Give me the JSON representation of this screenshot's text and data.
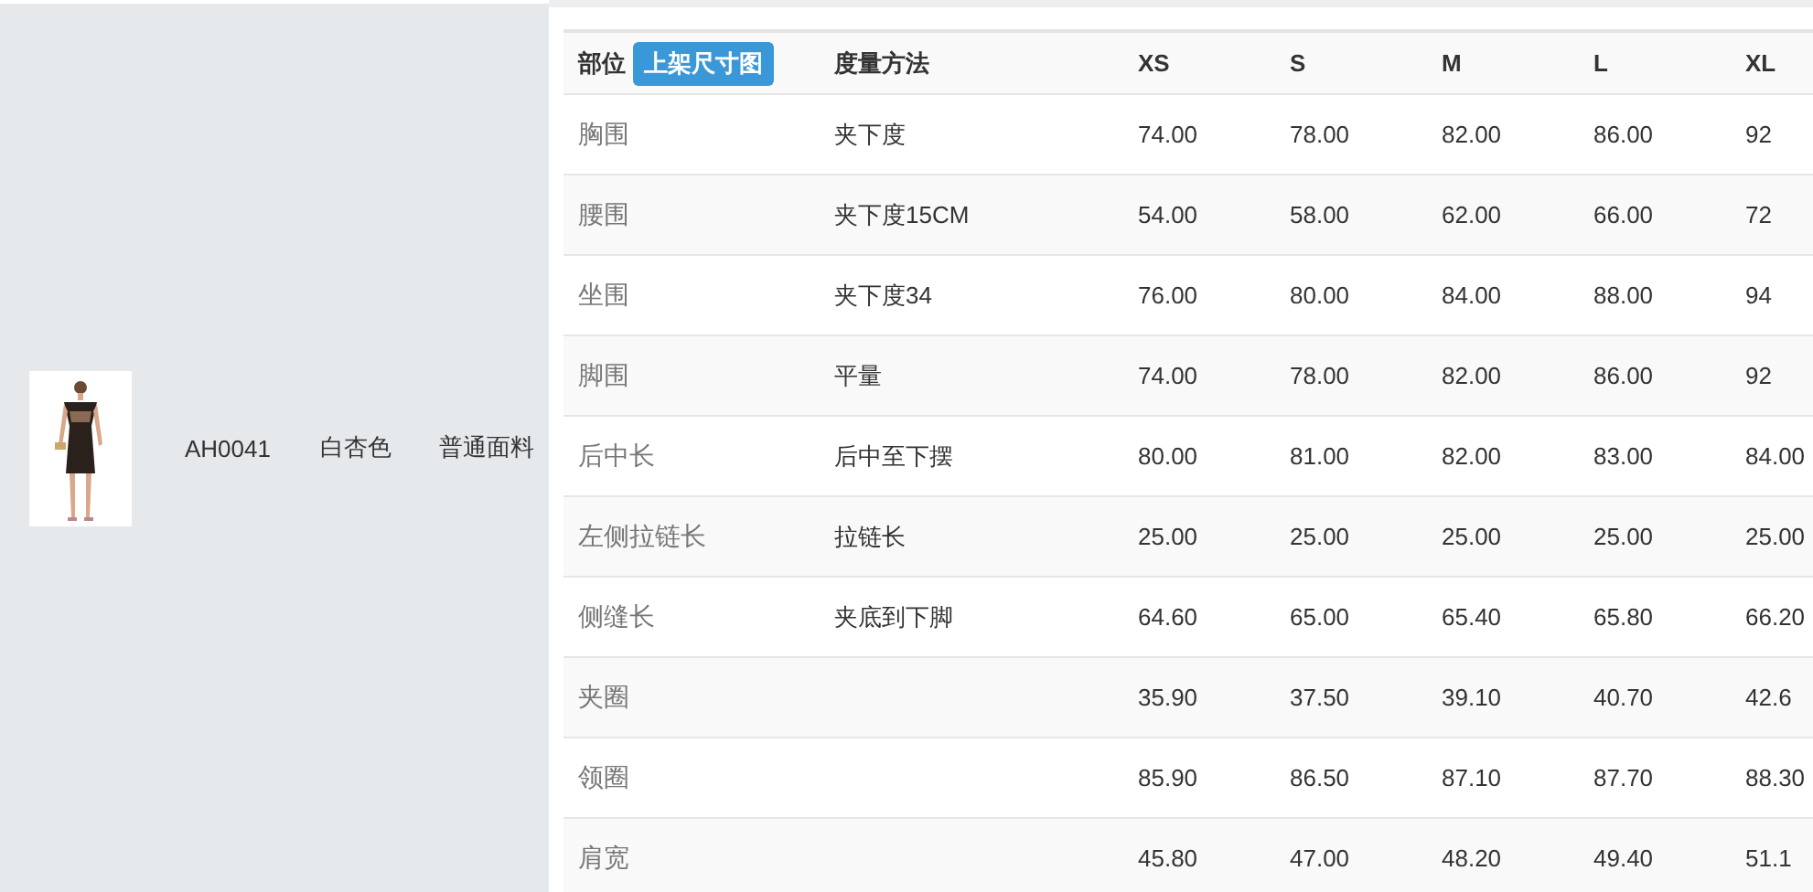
{
  "product": {
    "code": "AH0041",
    "shade": "白杏色",
    "fabric": "普通面料"
  },
  "size_table": {
    "columns": [
      "部位",
      "度量方法",
      "XS",
      "S",
      "M",
      "L",
      "XL"
    ],
    "header_button": "上架尺寸图",
    "rows": [
      {
        "part": "胸围",
        "method": "夹下度",
        "values": [
          "74.00",
          "78.00",
          "82.00",
          "86.00",
          "92"
        ]
      },
      {
        "part": "腰围",
        "method": "夹下度15CM",
        "values": [
          "54.00",
          "58.00",
          "62.00",
          "66.00",
          "72"
        ]
      },
      {
        "part": "坐围",
        "method": "夹下度34",
        "values": [
          "76.00",
          "80.00",
          "84.00",
          "88.00",
          "94"
        ]
      },
      {
        "part": "脚围",
        "method": "平量",
        "values": [
          "74.00",
          "78.00",
          "82.00",
          "86.00",
          "92"
        ]
      },
      {
        "part": "后中长",
        "method": "后中至下摆",
        "values": [
          "80.00",
          "81.00",
          "82.00",
          "83.00",
          "84.00"
        ]
      },
      {
        "part": "左侧拉链长",
        "method": "拉链长",
        "values": [
          "25.00",
          "25.00",
          "25.00",
          "25.00",
          "25.00"
        ]
      },
      {
        "part": "侧缝长",
        "method": "夹底到下脚",
        "values": [
          "64.60",
          "65.00",
          "65.40",
          "65.80",
          "66.20"
        ]
      },
      {
        "part": "夹圈",
        "values": [
          "35.90",
          "37.50",
          "39.10",
          "40.70",
          "42.6"
        ]
      },
      {
        "part": "领圈",
        "values": [
          "85.90",
          "86.50",
          "87.10",
          "87.70",
          "88.30"
        ]
      },
      {
        "part": "肩宽",
        "values": [
          "45.80",
          "47.00",
          "48.20",
          "49.40",
          "51.1"
        ]
      }
    ]
  }
}
